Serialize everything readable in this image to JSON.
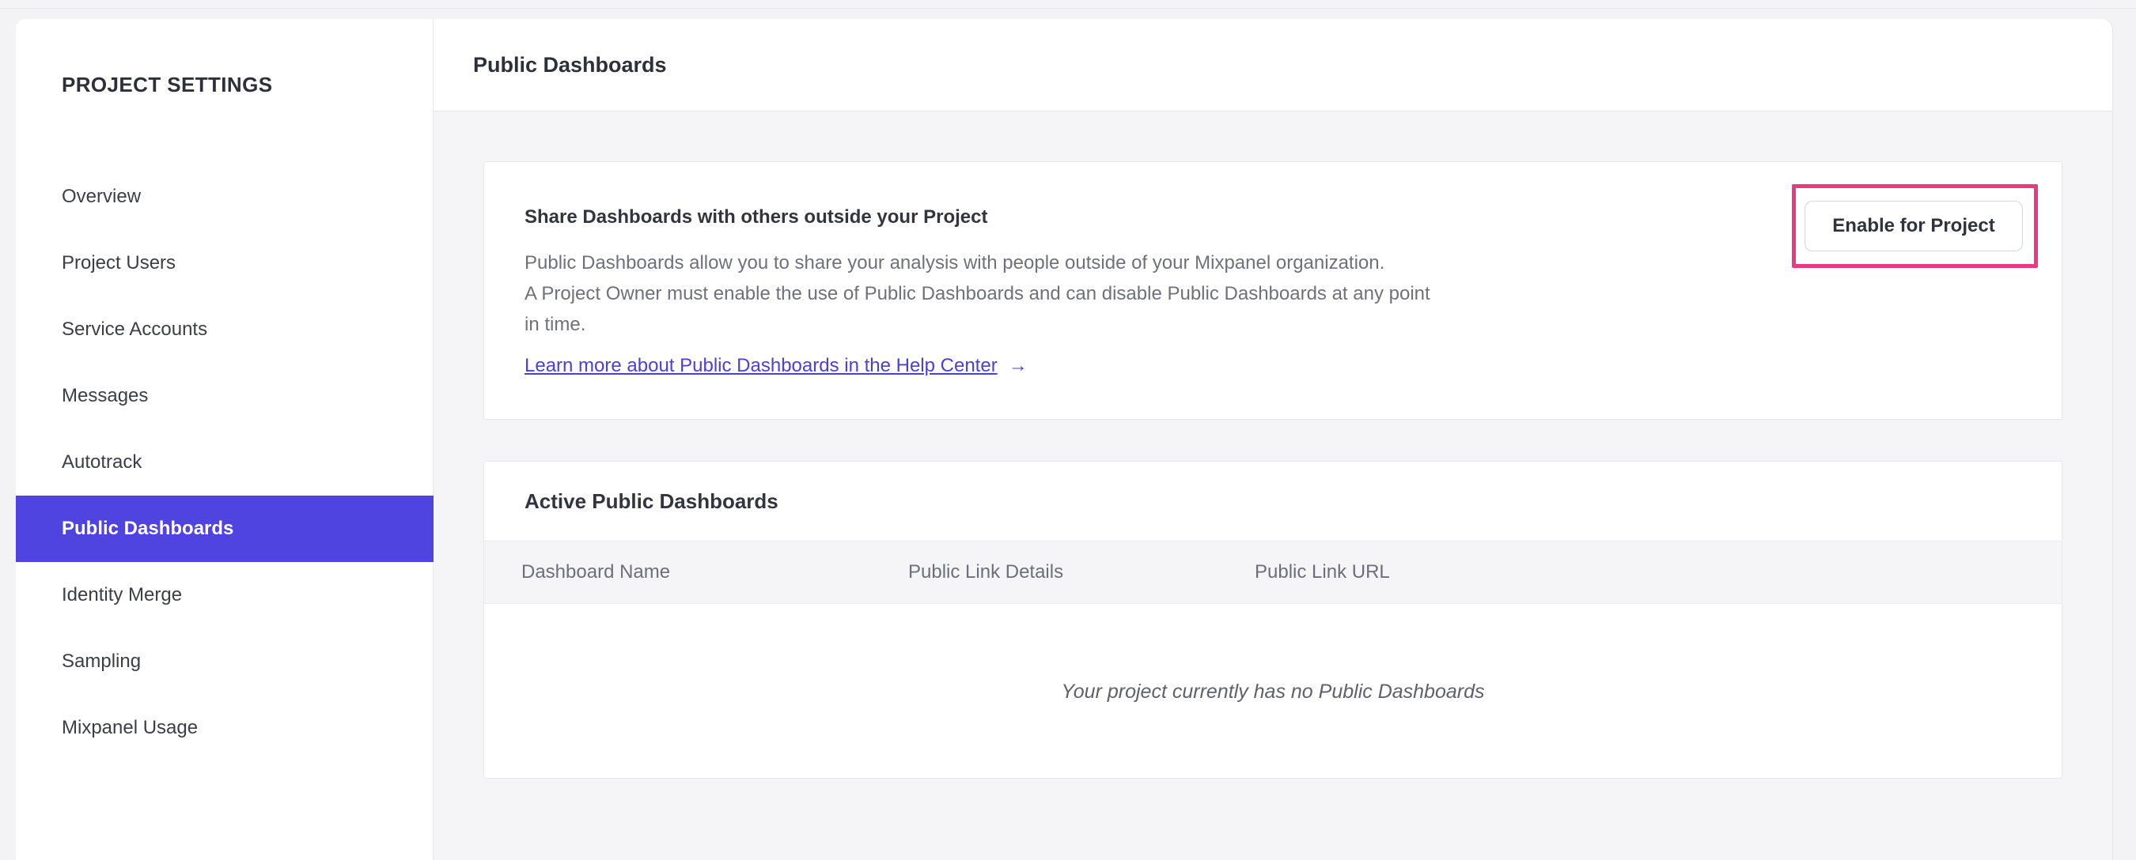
{
  "sidebar": {
    "heading": "PROJECT SETTINGS",
    "items": [
      {
        "label": "Overview",
        "active": false
      },
      {
        "label": "Project Users",
        "active": false
      },
      {
        "label": "Service Accounts",
        "active": false
      },
      {
        "label": "Messages",
        "active": false
      },
      {
        "label": "Autotrack",
        "active": false
      },
      {
        "label": "Public Dashboards",
        "active": true
      },
      {
        "label": "Identity Merge",
        "active": false
      },
      {
        "label": "Sampling",
        "active": false
      },
      {
        "label": "Mixpanel Usage",
        "active": false
      }
    ]
  },
  "header": {
    "title": "Public Dashboards"
  },
  "share_card": {
    "heading": "Share Dashboards with others outside your Project",
    "body_lines": [
      "Public Dashboards allow you to share your analysis with people outside of your Mixpanel organization.",
      "A Project Owner must enable the use of Public Dashboards and can disable Public Dashboards at any point",
      "in time."
    ],
    "link_label": "Learn more about Public Dashboards in the Help Center",
    "link_arrow": "→",
    "button_label": "Enable for Project"
  },
  "active_card": {
    "heading": "Active Public Dashboards",
    "columns": [
      "Dashboard Name",
      "Public Link Details",
      "Public Link URL"
    ],
    "empty_message": "Your project currently has no Public Dashboards"
  },
  "colors": {
    "accent_purple": "#4f44e0",
    "link_purple": "#4b3fd9",
    "highlight_pink": "#e83a80"
  }
}
